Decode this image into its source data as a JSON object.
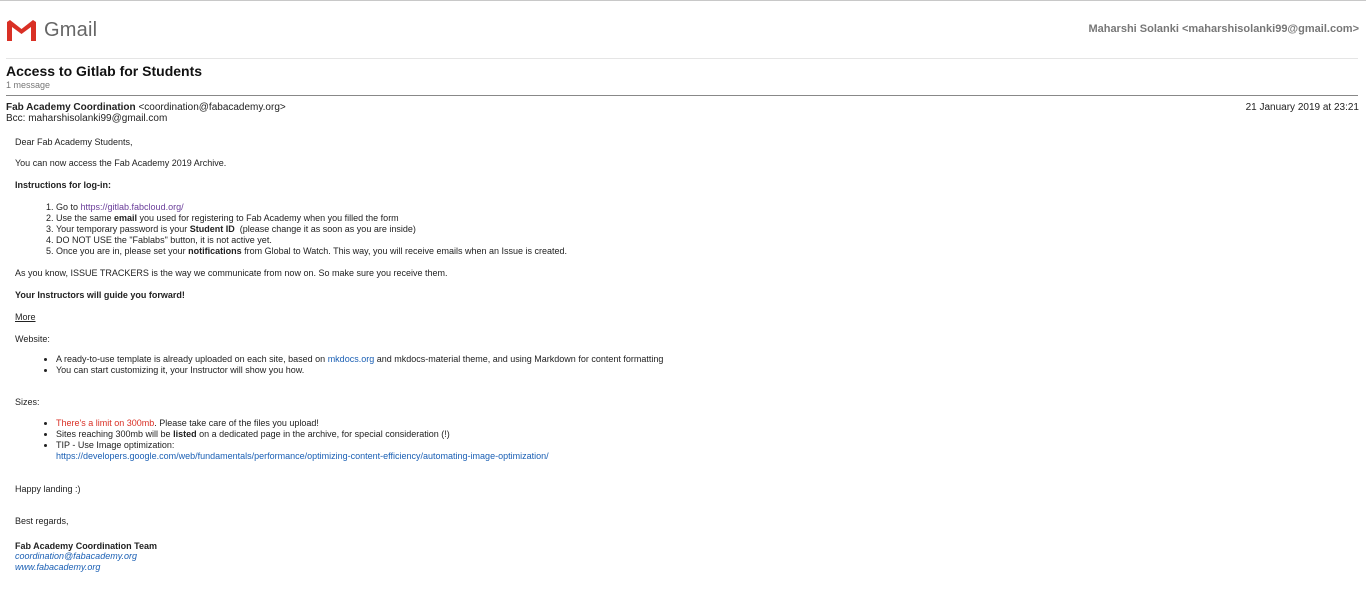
{
  "header": {
    "logo_text": "Gmail",
    "account": "Maharshi Solanki <maharshisolanki99@gmail.com>"
  },
  "thread": {
    "subject": "Access to Gitlab for Students",
    "count": "1 message"
  },
  "message": {
    "from_name": "Fab Academy Coordination",
    "from_email": "<coordination@fabacademy.org>",
    "bcc": "Bcc: maharshisolanki99@gmail.com",
    "date": "21 January 2019 at 23:21"
  },
  "body": {
    "greeting": "Dear Fab Academy Students,",
    "access": "You can now access the Fab Academy 2019 Archive.",
    "instructions_heading": "Instructions for log-in:",
    "steps": {
      "s1_pre": "Go to ",
      "s1_link": "https://gitlab.fabcloud.org/",
      "s2_pre": "Use the same ",
      "s2_bold": "email",
      "s2_post": " you used for registering to Fab Academy when you filled the form",
      "s3_pre": "Your temporary password is your ",
      "s3_bold": "Student ID",
      "s3_post": "  (please change it as soon as you are inside)",
      "s4": "DO NOT USE the \"Fablabs\" button, it is not active yet.",
      "s5_pre": "Once you are in, please set your ",
      "s5_bold": "notifications",
      "s5_post": " from Global to Watch. This way, you will receive emails when an Issue is created."
    },
    "issue_trackers": "As you know, ISSUE TRACKERS is the way we communicate from now on. So make sure you receive them.",
    "instructors": "Your Instructors will guide you forward!",
    "more": "More",
    "website_heading": "Website:",
    "website": {
      "w1_pre": "A ready-to-use template is already uploaded on each site, based on ",
      "w1_link": "mkdocs.org",
      "w1_post": " and mkdocs-material theme, and using Markdown for content formatting",
      "w2": "You can start customizing it, your Instructor will show you how."
    },
    "sizes_heading": "Sizes:",
    "sizes": {
      "z1_red": "There's a limit on 300mb",
      "z1_post": ". Please take care of the files you upload!",
      "z2_pre": "Sites reaching 300mb will be ",
      "z2_bold": "listed",
      "z2_post": " on a dedicated page in the archive, for special consideration (!)",
      "z3_pre": "TIP - Use Image optimization:",
      "z3_link": "https://developers.google.com/web/fundamentals/performance/optimizing-content-efficiency/automating-image-optimization/"
    },
    "happy": "Happy landing :)",
    "regards": "Best regards,",
    "team": "Fab Academy Coordination Team",
    "team_email": "coordination@fabacademy.org",
    "team_web": "www.fabacademy.org"
  },
  "colors": {
    "link": "#1a5fb4",
    "visited": "#6a3d9a",
    "warning": "#d93025",
    "gmail_red": "#d93025"
  },
  "icons": [
    "gmail-logo-icon"
  ]
}
